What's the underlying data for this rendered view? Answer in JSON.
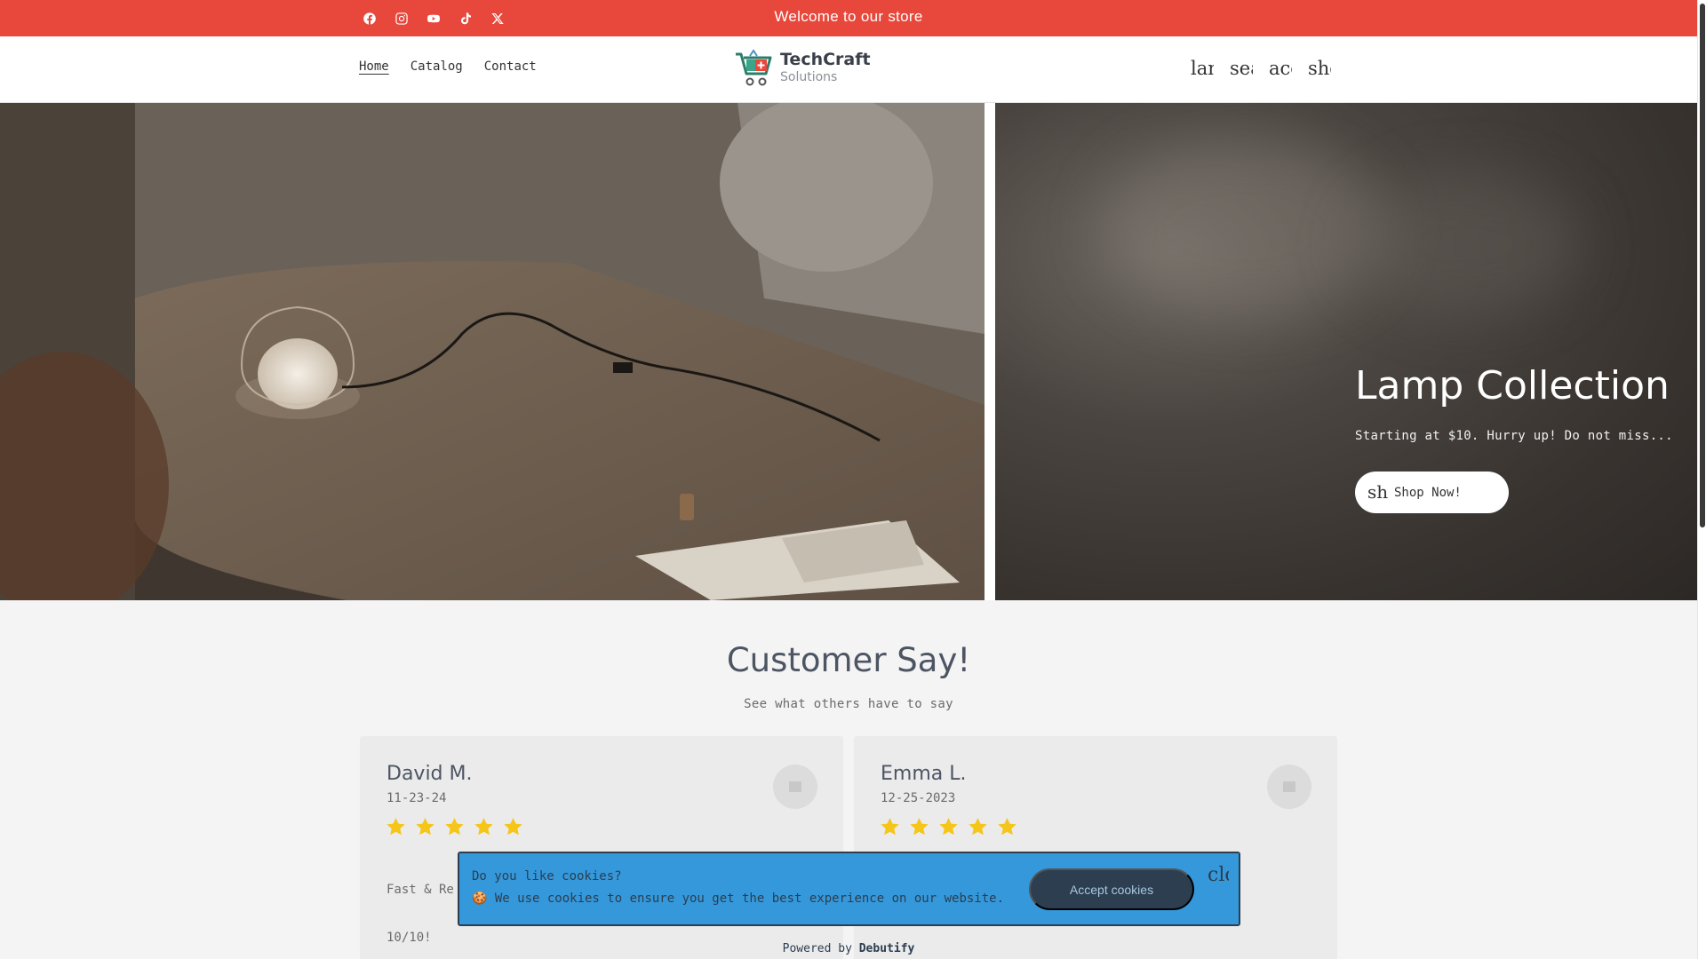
{
  "announcement": {
    "text": "Welcome to our store",
    "socials": [
      "facebook-icon",
      "instagram-icon",
      "youtube-icon",
      "tiktok-icon",
      "x-icon"
    ]
  },
  "nav": {
    "items": [
      "Home",
      "Catalog",
      "Contact"
    ],
    "active": "Home"
  },
  "logo": {
    "name": "TechCraft",
    "subtitle": "Solutions"
  },
  "header_icons": [
    {
      "name": "language-icon",
      "glyph": "lan"
    },
    {
      "name": "search-icon",
      "glyph": "sea"
    },
    {
      "name": "account-icon",
      "glyph": "acc"
    },
    {
      "name": "shopping-cart-icon",
      "glyph": "sho"
    }
  ],
  "hero": {
    "title": "Lamp Collection",
    "subtitle": "Starting at $10. Hurry up! Do not miss...",
    "button_glyph": "sho",
    "button_label": "Shop Now!"
  },
  "testimonials": {
    "title": "Customer Say!",
    "subtitle": "See what others have to say",
    "items": [
      {
        "name": "David M.",
        "date": "11-23-24",
        "rating": 5,
        "lines": [
          "Fast & Re",
          "10/10!"
        ]
      },
      {
        "name": "Emma L.",
        "date": "12-25-2023",
        "rating": 5,
        "lines": [
          "",
          ""
        ]
      }
    ]
  },
  "cookie": {
    "title": "Do you like cookies?",
    "text": "🍪 We use cookies to ensure you get the best experience on our website.",
    "accept_label": "Accept cookies",
    "close_glyph": "clo",
    "powered_prefix": "Powered by ",
    "powered_brand": "Debutify"
  },
  "colors": {
    "announcement_bg": "#e8473b",
    "cookie_bg": "#3498db",
    "cookie_button": "#2c3e50",
    "star": "#f5c518"
  }
}
